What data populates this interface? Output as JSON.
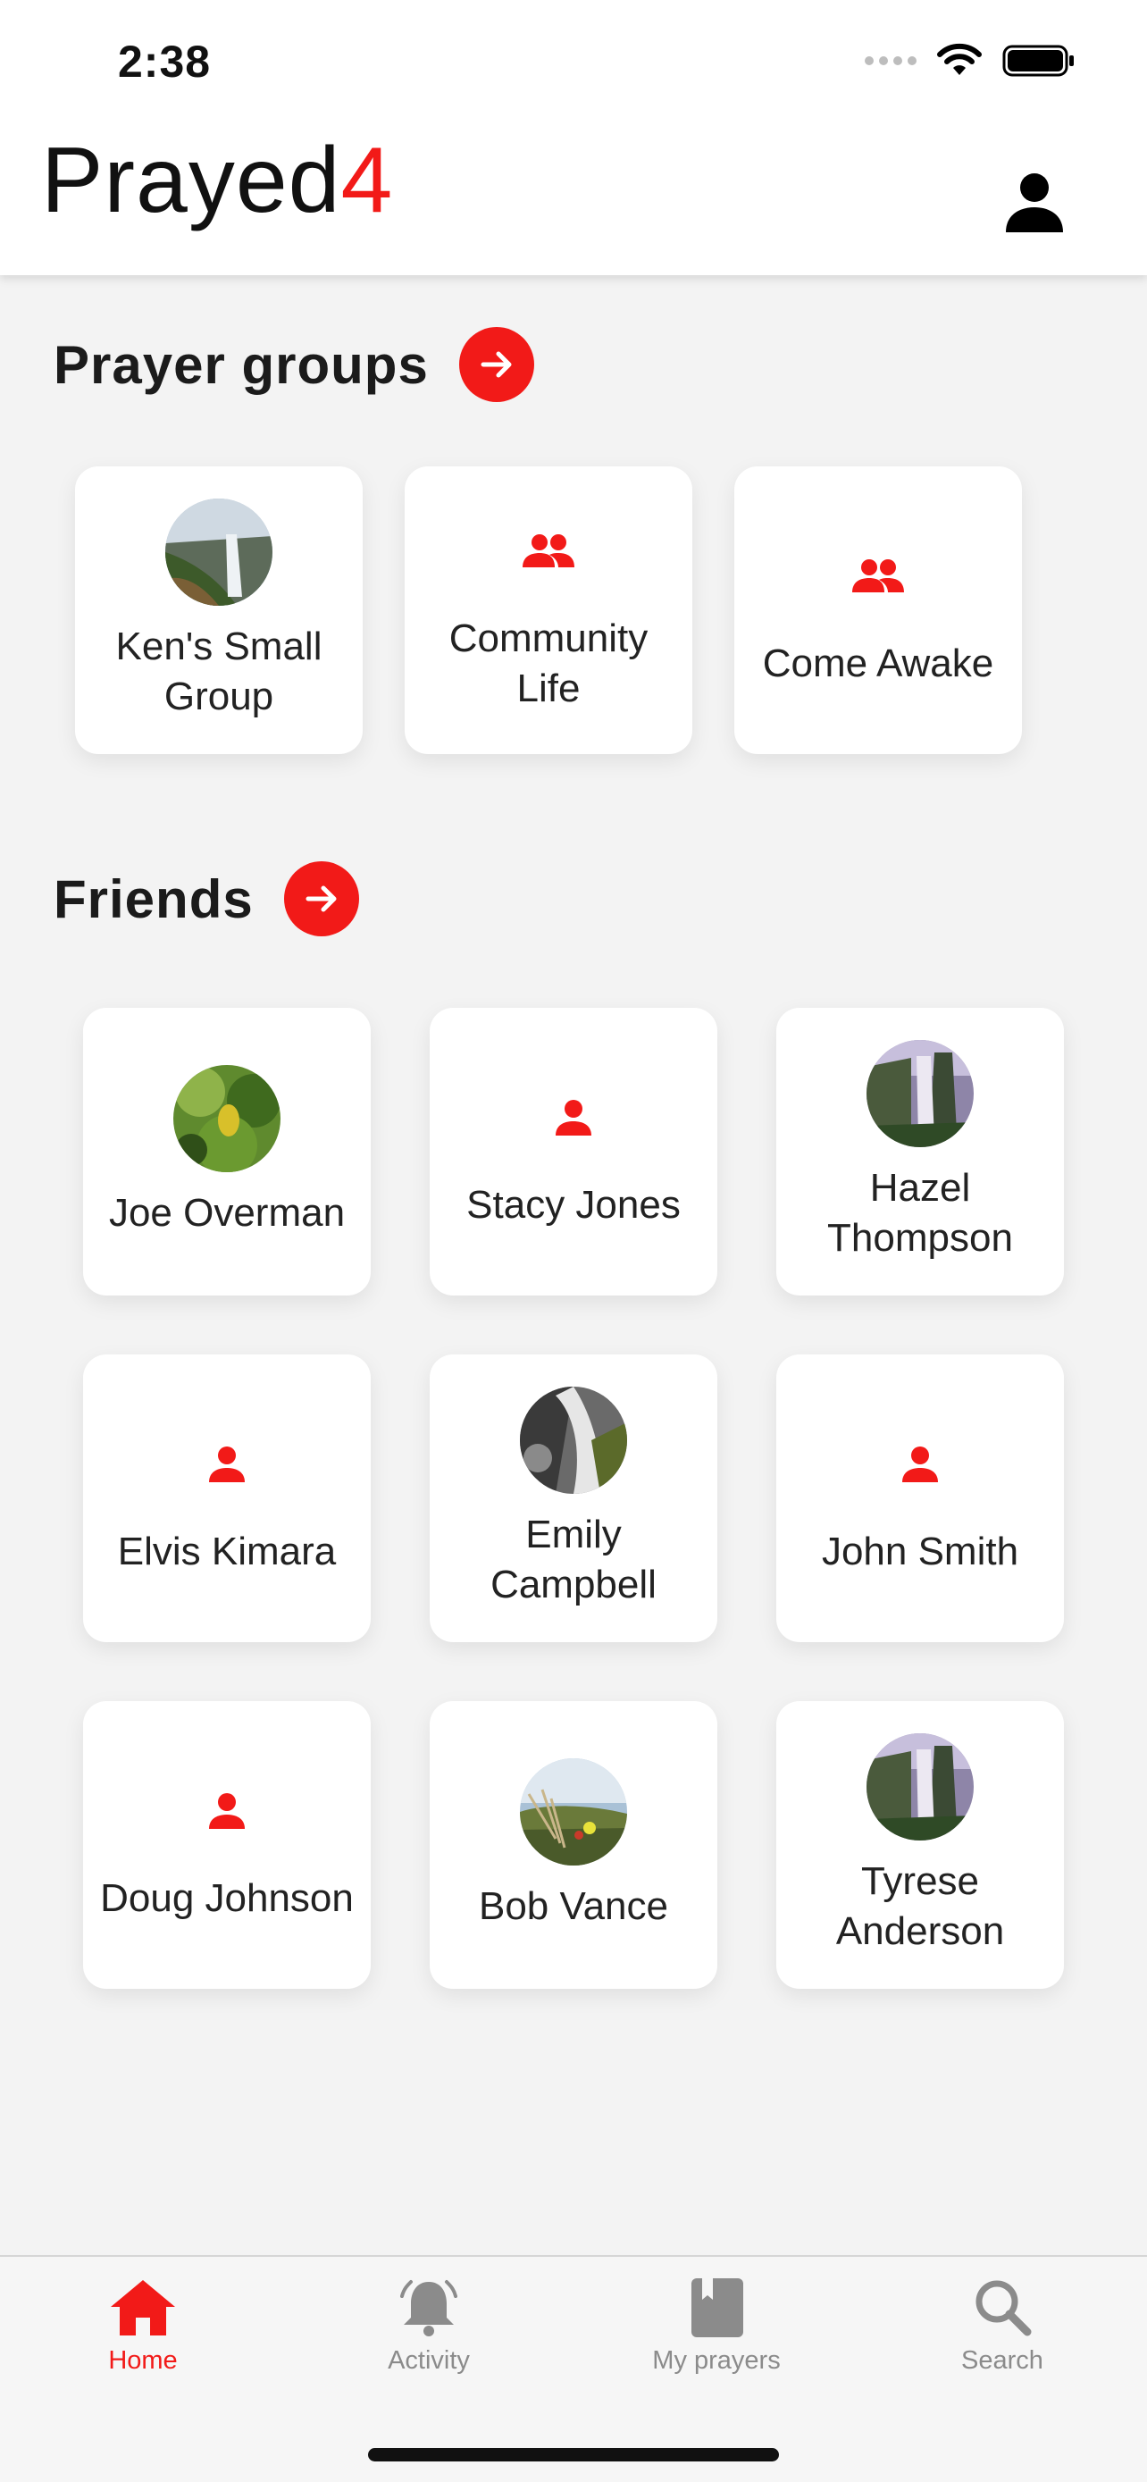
{
  "status_bar": {
    "time": "2:38"
  },
  "app": {
    "title_main": "Prayed",
    "title_accent": "4",
    "accent_color": "#f21a18"
  },
  "prayer_groups": {
    "title": "Prayer groups",
    "items": [
      {
        "label": "Ken's Small Group",
        "icon": "group-photo"
      },
      {
        "label": "Community Life",
        "icon": "group-icon"
      },
      {
        "label": "Come Awake",
        "icon": "group-icon"
      }
    ]
  },
  "friends": {
    "title": "Friends",
    "items": [
      {
        "label": "Joe Overman",
        "icon": "photo"
      },
      {
        "label": "Stacy Jones",
        "icon": "person-icon"
      },
      {
        "label": "Hazel Thompson",
        "icon": "photo"
      },
      {
        "label": "Elvis Kimara",
        "icon": "person-icon"
      },
      {
        "label": "Emily Campbell",
        "icon": "photo"
      },
      {
        "label": "John Smith",
        "icon": "person-icon"
      },
      {
        "label": "Doug Johnson",
        "icon": "person-icon"
      },
      {
        "label": "Bob Vance",
        "icon": "photo"
      },
      {
        "label": "Tyrese Anderson",
        "icon": "photo"
      }
    ]
  },
  "tabbar": {
    "tabs": [
      {
        "label": "Home",
        "icon": "home-icon",
        "active": true
      },
      {
        "label": "Activity",
        "icon": "bell-icon",
        "active": false
      },
      {
        "label": "My prayers",
        "icon": "book-icon",
        "active": false
      },
      {
        "label": "Search",
        "icon": "search-icon",
        "active": false
      }
    ]
  }
}
